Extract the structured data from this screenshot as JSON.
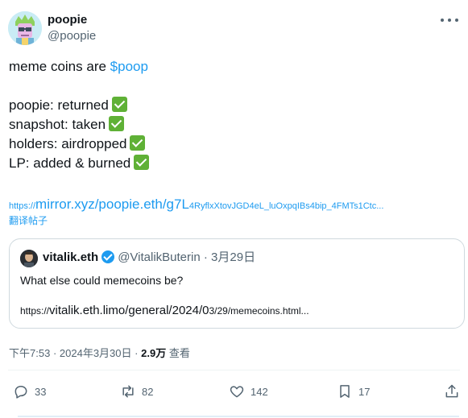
{
  "author": {
    "name": "poopie",
    "handle": "@poopie",
    "avatar_icon": "punk-avatar-icon"
  },
  "tweet": {
    "line1_prefix": "meme coins are ",
    "cashtag": "$poop",
    "items": [
      "poopie: returned",
      "snapshot: taken",
      "holders: airdropped",
      "LP: added & burned"
    ],
    "link_prefix": "https://",
    "link_main": "mirror.xyz/poopie.eth/g7L",
    "link_tail": "4RyflxXtovJGD4eL_luOxpqIBs4bip_4FMTs1Ctc...",
    "translate_label": "翻译帖子"
  },
  "quote": {
    "name": "vitalik.eth",
    "handle": "@VitalikButerin",
    "separator": "·",
    "date": "3月29日",
    "text": "What else could memecoins be?",
    "link_prefix": "https://",
    "link_main": "vitalik.eth.limo/general/2024/0",
    "link_tail": "3/29/memecoins.html..."
  },
  "meta": {
    "time": "下午7:53",
    "separator": "·",
    "date": "2024年3月30日",
    "views_count": "2.9万",
    "views_label": "查看"
  },
  "actions": {
    "reply_count": "33",
    "retweet_count": "82",
    "like_count": "142",
    "bookmark_count": "17"
  },
  "colors": {
    "accent": "#1d9bf0",
    "secondary_text": "#536471",
    "check_green": "#5fb136"
  }
}
